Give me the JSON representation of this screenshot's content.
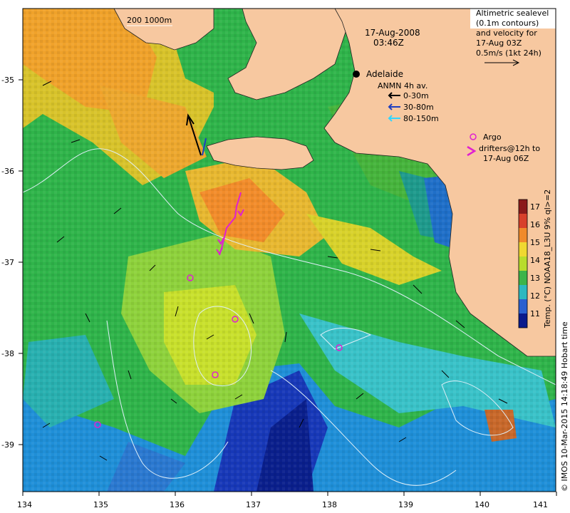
{
  "map": {
    "date": "17-Aug-2008",
    "time": "03:46Z",
    "city": "Adelaide",
    "bathymetry_label": "200  1000m",
    "altimetry_lines": [
      "Altimetric sealevel",
      "(0.1m contours)",
      "and velocity for",
      "17-Aug 03Z",
      "0.5m/s (1kt 24h)"
    ],
    "anmn_title": "ANMN 4h av.",
    "anmn_legend": [
      {
        "label": "0-30m",
        "color": "#000000"
      },
      {
        "label": "30-80m",
        "color": "#1f3fbf"
      },
      {
        "label": "80-150m",
        "color": "#33d6ff"
      }
    ],
    "argo_label": "Argo",
    "drifter_label_1": "drifters@12h to",
    "drifter_label_2": "17-Aug 06Z",
    "argo_color": "#e020d0",
    "colorbar_title": "Temp. (°C) NOAA18_L3U 9% ql>=2",
    "colorbar_ticks": [
      "17",
      "16",
      "15",
      "14",
      "13",
      "12",
      "11"
    ],
    "credit": "© IMOS 10-Mar-2015 14:18:49 Hobart time",
    "x_ticks": [
      "134",
      "135",
      "136",
      "137",
      "138",
      "139",
      "140",
      "141"
    ],
    "y_ticks": [
      "-35",
      "-36",
      "-37",
      "-38",
      "-39"
    ],
    "land_color": "#f7c8a0"
  }
}
